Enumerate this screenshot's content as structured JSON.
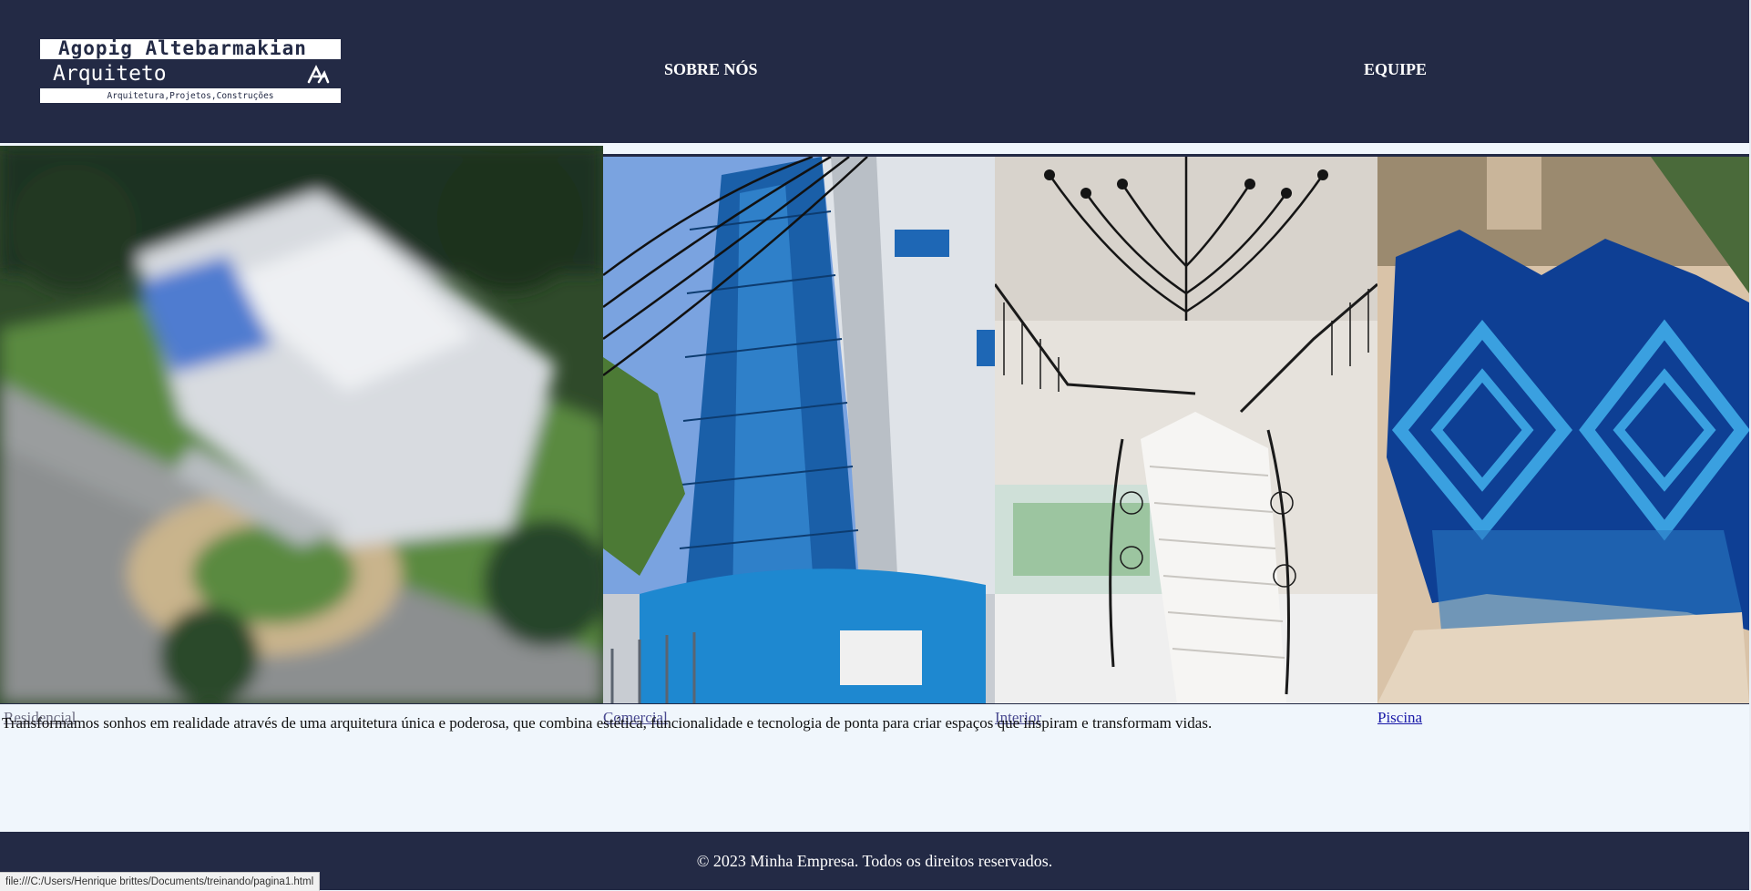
{
  "header": {
    "logo": {
      "line1": "Agopig Altebarmakian",
      "line2": "Arquiteto",
      "line3": "Arquitetura,Projetos,Construções"
    },
    "nav": [
      {
        "label": "SOBRE NÓS"
      },
      {
        "label": "EQUIPE"
      }
    ]
  },
  "gallery": {
    "items": [
      {
        "caption": "Residencial",
        "image": "aerial-house-photo"
      },
      {
        "caption": "Comercial",
        "image": "glass-building-photo"
      },
      {
        "caption": "Interior",
        "image": "staircase-chandelier-photo"
      },
      {
        "caption": "Piscina",
        "image": "pool-photo"
      }
    ]
  },
  "intro": "Transformamos sonhos em realidade através de uma arquitetura única e poderosa, que combina estética, funcionalidade e tecnologia de ponta para criar espaços que inspiram e transformam vidas.",
  "footer": {
    "text": "© 2023 Minha Empresa. Todos os direitos reservados."
  },
  "status_url": "file:///C:/Users/Henrique brittes/Documents/treinando/pagina1.html",
  "colors": {
    "navy": "#232a45",
    "page_bg": "#f0f6fc",
    "pool_blue": "#1f5fb8"
  }
}
